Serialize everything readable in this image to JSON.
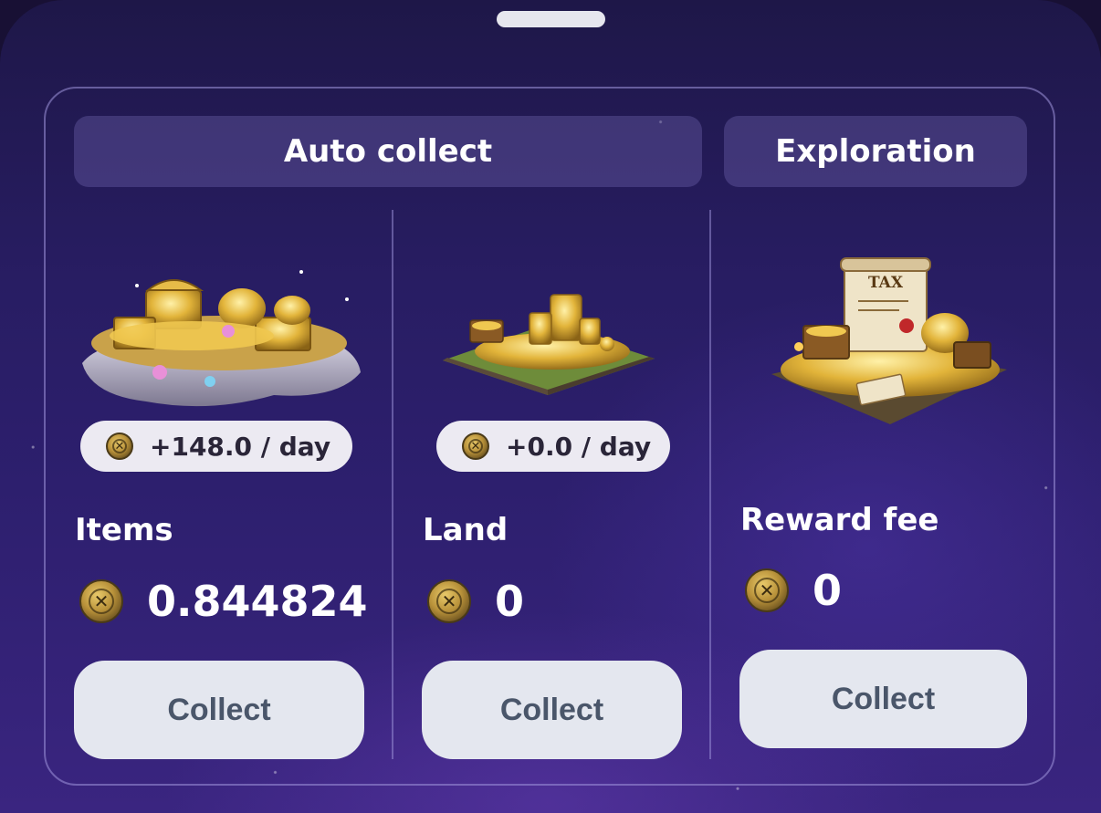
{
  "headers": {
    "auto_collect": "Auto collect",
    "exploration": "Exploration"
  },
  "items": {
    "rate": "+148.0 / day",
    "title": "Items",
    "amount": "0.844824",
    "collect_label": "Collect"
  },
  "land": {
    "rate": "+0.0 / day",
    "title": "Land",
    "amount": "0",
    "collect_label": "Collect"
  },
  "reward": {
    "title": "Reward fee",
    "amount": "0",
    "collect_label": "Collect",
    "sign_label": "TAX"
  },
  "icons": {
    "coin": "expo-coin-icon",
    "items_art": "treasure-island-illustration",
    "land_art": "gold-land-plot-illustration",
    "reward_art": "tax-treasure-illustration"
  },
  "colors": {
    "background": "#2d1f6e",
    "header_bg": "#4a3f8a",
    "button_bg": "#e4e7ef",
    "button_text": "#4a566a",
    "pill_bg": "#eceaf2"
  }
}
